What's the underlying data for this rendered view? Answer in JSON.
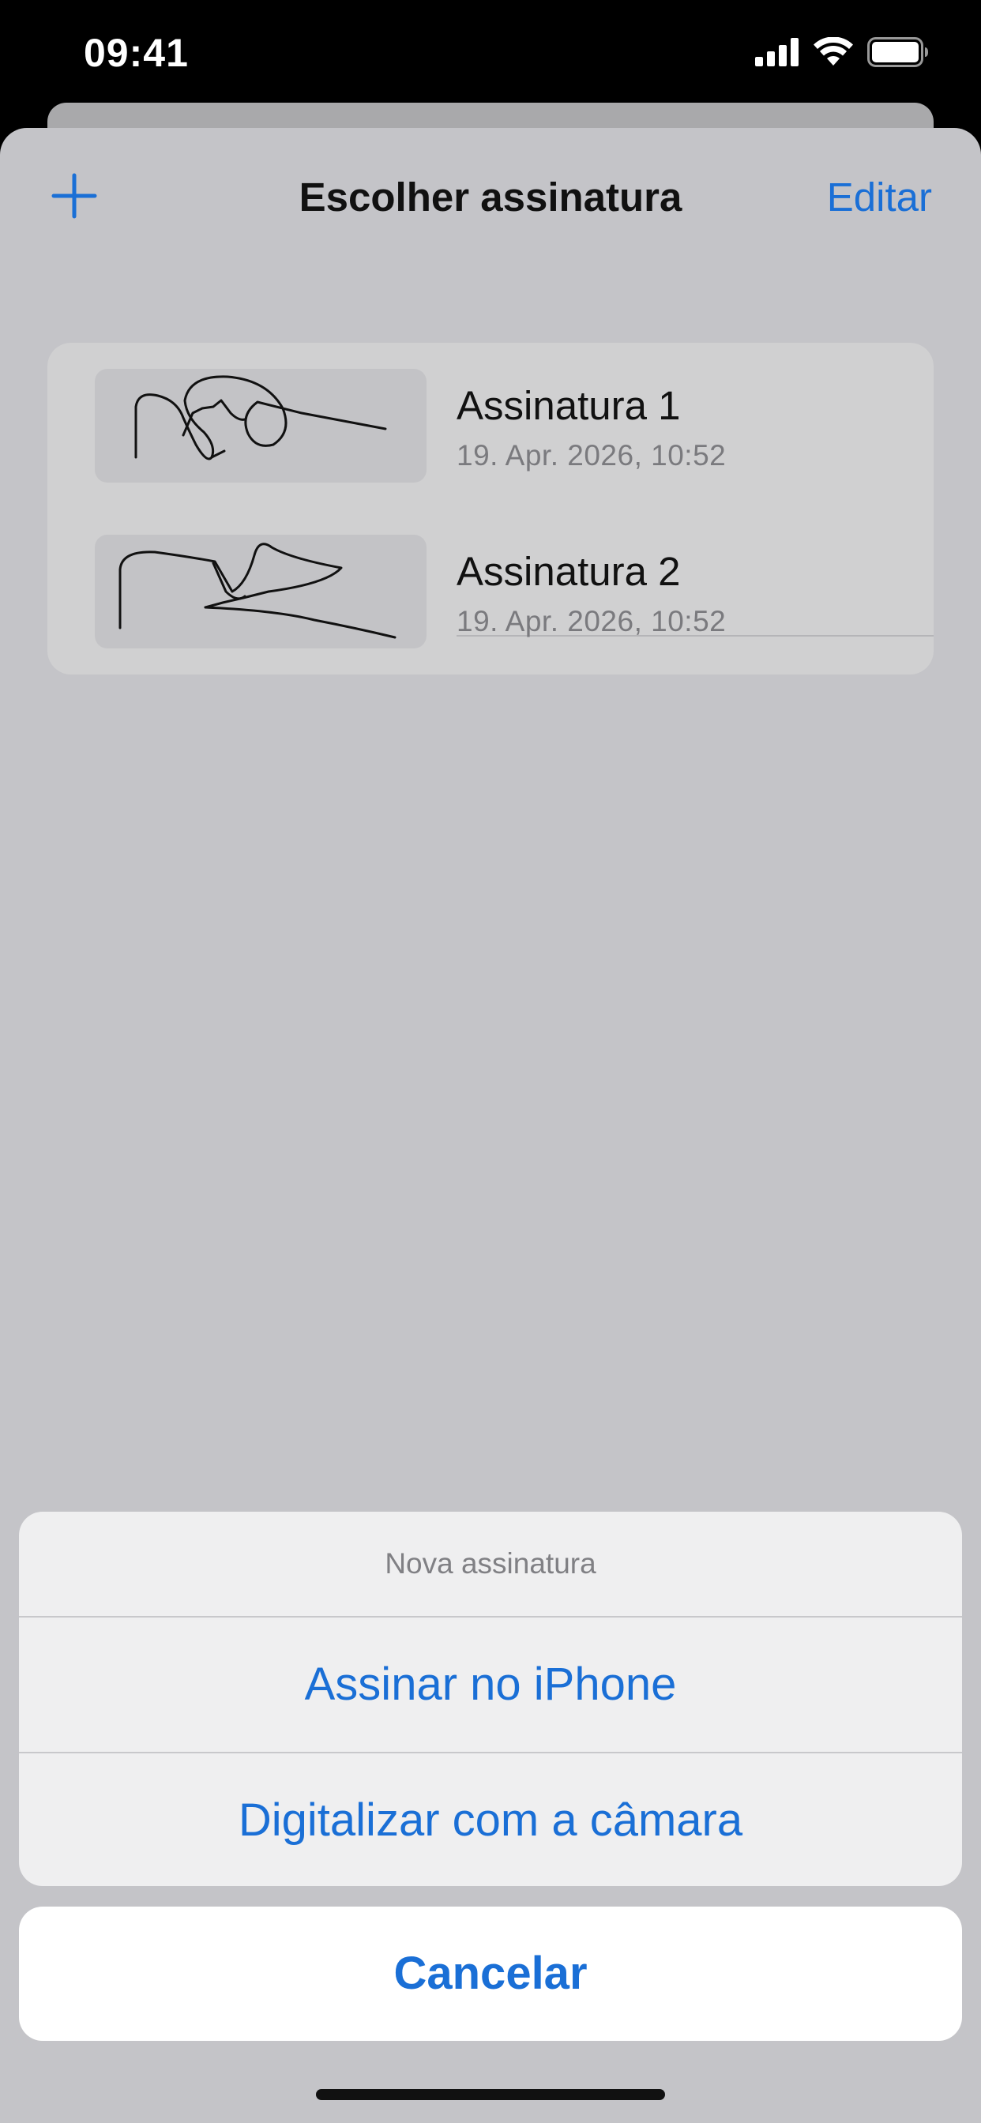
{
  "status_bar": {
    "time": "09:41",
    "icons": [
      "cellular-signal-icon",
      "wifi-icon",
      "battery-icon"
    ]
  },
  "nav": {
    "add_icon": "plus-icon",
    "title": "Escolher assinatura",
    "edit_label": "Editar"
  },
  "signatures": [
    {
      "name": "Assinatura 1",
      "date": "19. Apr. 2026, 10:52"
    },
    {
      "name": "Assinatura 2",
      "date": "19. Apr. 2026, 10:52"
    }
  ],
  "action_sheet": {
    "title": "Nova assinatura",
    "actions": [
      "Assinar no iPhone",
      "Digitalizar com a câmara"
    ],
    "cancel_label": "Cancelar"
  },
  "colors": {
    "accent": "#1a6fd6",
    "sheet_background": "#c4c4c8",
    "list_background": "#d0d0d1"
  }
}
